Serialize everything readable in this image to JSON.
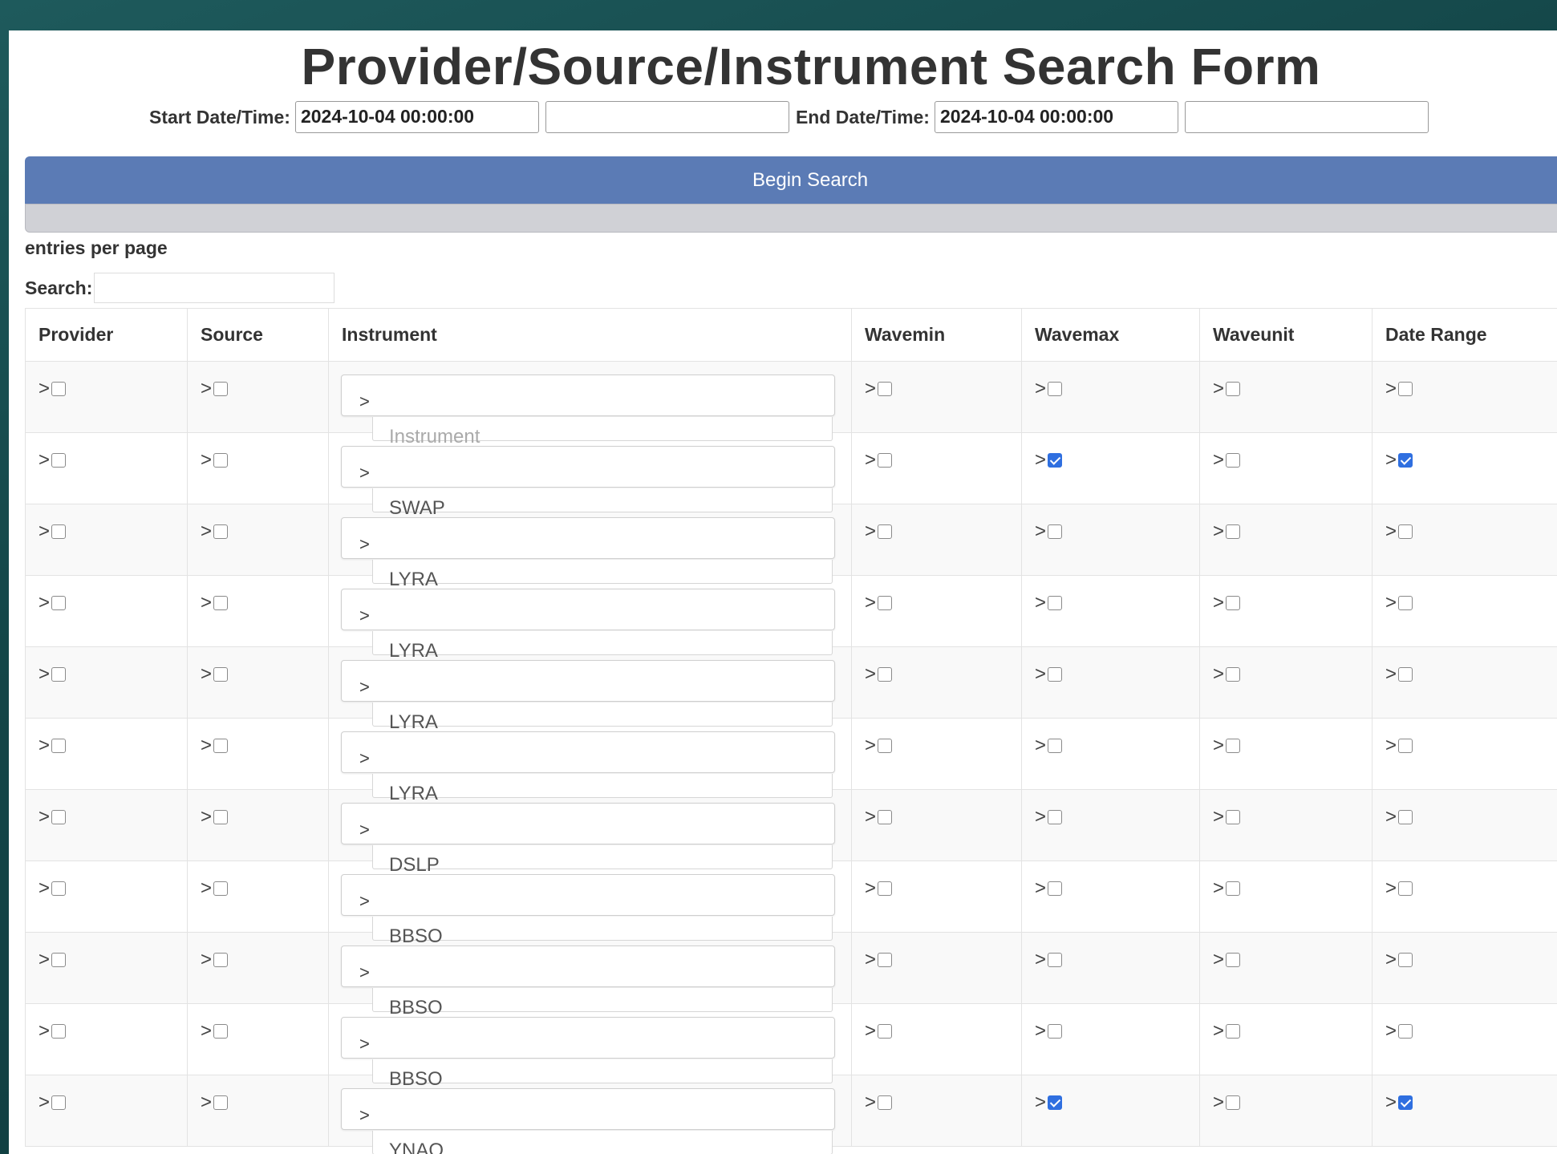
{
  "title": "Provider/Source/Instrument Search Form",
  "dates": {
    "start_label": "Start Date/Time:",
    "start_value": "2024-10-04 00:00:00",
    "start_extra": "",
    "end_label": "End Date/Time:",
    "end_value": "2024-10-04 00:00:00",
    "end_extra": ""
  },
  "begin_label": "Begin Search",
  "entries_label": "entries per page",
  "search_label": "Search:",
  "columns": [
    "Provider",
    "Source",
    "Instrument",
    "Wavemin",
    "Wavemax",
    "Waveunit",
    "Date Range"
  ],
  "row_prefix": ">",
  "rows": [
    {
      "instrument": "Instrument",
      "placeholder": true,
      "wavemax": false,
      "daterange": false
    },
    {
      "instrument": "SWAP",
      "wavemax": true,
      "daterange": true
    },
    {
      "instrument": "LYRA",
      "wavemax": false,
      "daterange": false
    },
    {
      "instrument": "LYRA",
      "wavemax": false,
      "daterange": false
    },
    {
      "instrument": "LYRA",
      "wavemax": false,
      "daterange": false
    },
    {
      "instrument": "LYRA",
      "wavemax": false,
      "daterange": false
    },
    {
      "instrument": "DSLP",
      "wavemax": false,
      "daterange": false
    },
    {
      "instrument": "BBSO",
      "wavemax": false,
      "daterange": false
    },
    {
      "instrument": "BBSO",
      "wavemax": false,
      "daterange": false
    },
    {
      "instrument": "BBSO",
      "wavemax": false,
      "daterange": false
    },
    {
      "instrument": "YNAO",
      "wavemax": true,
      "daterange": true
    }
  ],
  "colors": {
    "accent": "#5b7bb5",
    "checkbox": "#2f6fe0"
  }
}
